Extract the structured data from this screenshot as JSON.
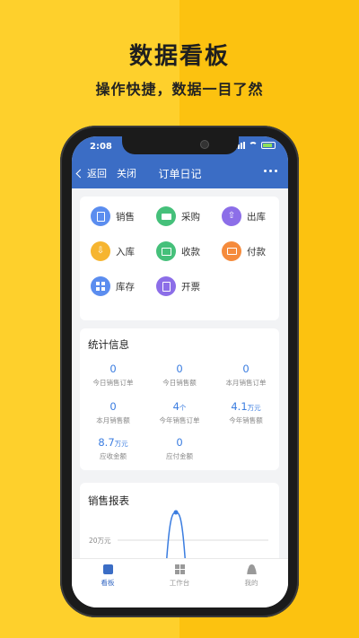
{
  "promo": {
    "headline": "数据看板",
    "subline": "操作快捷，数据一目了然"
  },
  "status_bar": {
    "time": "2:08"
  },
  "nav": {
    "back_label": "返回",
    "close_label": "关闭",
    "title": "订单日记"
  },
  "functions": [
    {
      "label": "销售",
      "icon": "clipboard-icon",
      "color": "#5b8def"
    },
    {
      "label": "采购",
      "icon": "truck-icon",
      "color": "#45c07a"
    },
    {
      "label": "出库",
      "icon": "upload-icon",
      "color": "#8c6ee8"
    },
    {
      "label": "入库",
      "icon": "download-icon",
      "color": "#f6b530"
    },
    {
      "label": "收款",
      "icon": "money-icon",
      "color": "#45c07a"
    },
    {
      "label": "付款",
      "icon": "card-icon",
      "color": "#f58b3c"
    },
    {
      "label": "库存",
      "icon": "grid-icon",
      "color": "#5b8def"
    },
    {
      "label": "开票",
      "icon": "document-icon",
      "color": "#8c6ee8"
    }
  ],
  "stats": {
    "title": "统计信息",
    "items": [
      {
        "value": "0",
        "unit": "",
        "label": "今日销售订单"
      },
      {
        "value": "0",
        "unit": "",
        "label": "今日销售额"
      },
      {
        "value": "0",
        "unit": "",
        "label": "本月销售订单"
      },
      {
        "value": "0",
        "unit": "",
        "label": "本月销售额"
      },
      {
        "value": "4",
        "unit": "个",
        "label": "今年销售订单"
      },
      {
        "value": "4.1",
        "unit": "万元",
        "label": "今年销售额"
      },
      {
        "value": "8.7",
        "unit": "万元",
        "label": "应收金额"
      },
      {
        "value": "0",
        "unit": "",
        "label": "应付金额"
      }
    ]
  },
  "report": {
    "title": "销售报表",
    "y_tick": "20万元"
  },
  "chart_data": {
    "type": "line",
    "title": "销售报表",
    "yticks": [
      "20万元"
    ],
    "series": [
      {
        "values": [
          0,
          4.1,
          0
        ]
      }
    ]
  },
  "tabs": [
    {
      "label": "看板",
      "icon": "chart-icon",
      "active": true
    },
    {
      "label": "工作台",
      "icon": "workbench-icon",
      "active": false
    },
    {
      "label": "我的",
      "icon": "user-icon",
      "active": false
    }
  ]
}
